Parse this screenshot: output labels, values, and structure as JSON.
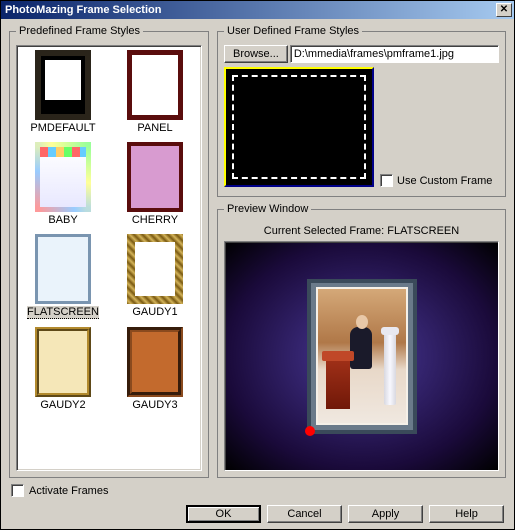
{
  "window": {
    "title": "PhotoMazing Frame Selection"
  },
  "predefined": {
    "legend": "Predefined Frame Styles",
    "items": [
      {
        "label": "PMDEFAULT",
        "style": "pmdefault"
      },
      {
        "label": "PANEL",
        "style": "panel"
      },
      {
        "label": "BABY",
        "style": "baby"
      },
      {
        "label": "CHERRY",
        "style": "cherry"
      },
      {
        "label": "FLATSCREEN",
        "style": "flatscreen"
      },
      {
        "label": "GAUDY1",
        "style": "gaudy1"
      },
      {
        "label": "GAUDY2",
        "style": "gaudy2"
      },
      {
        "label": "GAUDY3",
        "style": "gaudy3"
      }
    ],
    "selected_index": 4
  },
  "userdefined": {
    "legend": "User Defined Frame Styles",
    "browse_label": "Browse...",
    "path_value": "D:\\mmedia\\frames\\pmframe1.jpg",
    "use_custom_label": "Use Custom Frame",
    "use_custom_checked": false
  },
  "preview": {
    "legend": "Preview Window",
    "current_label": "Current Selected Frame: FLATSCREEN"
  },
  "activate": {
    "label": "Activate Frames",
    "checked": false
  },
  "buttons": {
    "ok": "OK",
    "cancel": "Cancel",
    "apply": "Apply",
    "help": "Help"
  }
}
